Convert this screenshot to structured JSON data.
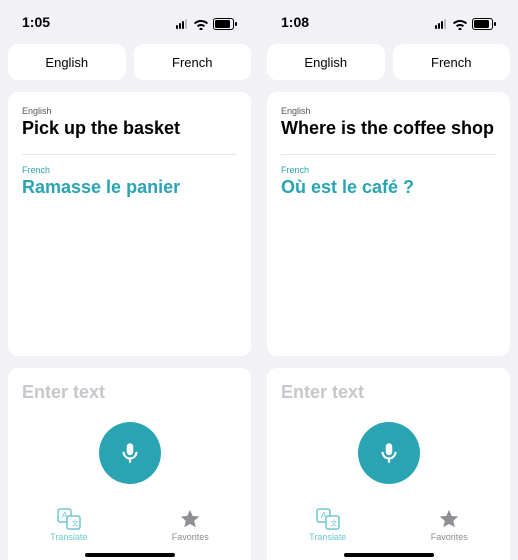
{
  "accent": "#2aa4b3",
  "screens": [
    {
      "status": {
        "time": "1:05"
      },
      "lang": {
        "source": "English",
        "target": "French"
      },
      "source": {
        "label": "English",
        "text": "Pick up the basket"
      },
      "target": {
        "label": "French",
        "text": "Ramasse le panier"
      },
      "input": {
        "placeholder": "Enter text"
      },
      "tabs": {
        "translate": "Translate",
        "favorites": "Favorites"
      }
    },
    {
      "status": {
        "time": "1:08"
      },
      "lang": {
        "source": "English",
        "target": "French"
      },
      "source": {
        "label": "English",
        "text": "Where is the coffee shop"
      },
      "target": {
        "label": "French",
        "text": "Où est le café ?"
      },
      "input": {
        "placeholder": "Enter text"
      },
      "tabs": {
        "translate": "Translate",
        "favorites": "Favorites"
      }
    }
  ]
}
